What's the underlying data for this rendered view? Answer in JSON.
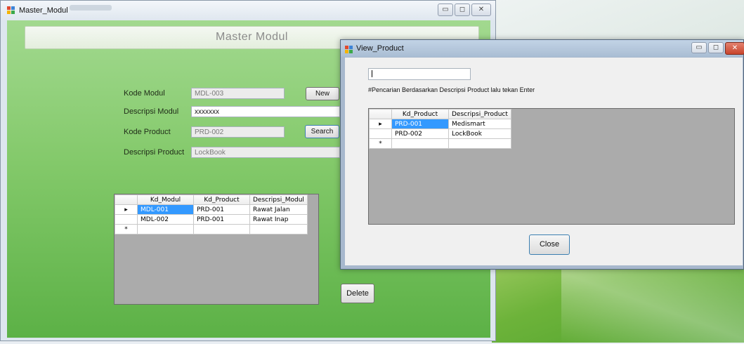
{
  "master": {
    "title": "Master_Modul",
    "header_title": "Master Modul",
    "labels": {
      "kode_modul": "Kode Modul",
      "descripsi_modul": "Descripsi Modul",
      "kode_product": "Kode Product",
      "descripsi_product": "Descripsi Product"
    },
    "fields": {
      "kode_modul": "MDL-003",
      "descripsi_modul": "xxxxxxx",
      "kode_product": "PRD-002",
      "descripsi_product": "LockBook"
    },
    "buttons": {
      "new": "New",
      "search": "Search",
      "delete": "Delete"
    },
    "grid": {
      "columns": [
        "Kd_Modul",
        "Kd_Product",
        "Descripsi_Modul"
      ],
      "rows": [
        [
          "MDL-001",
          "PRD-001",
          "Rawat Jalan"
        ],
        [
          "MDL-002",
          "PRD-001",
          "Rawat Inap"
        ]
      ],
      "new_row_marker": "*",
      "current_row_marker": "▸"
    }
  },
  "view_product": {
    "title": "View_Product",
    "search_value": "",
    "hint": "#Pencarian Berdasarkan Descripsi Product lalu tekan Enter",
    "grid": {
      "columns": [
        "Kd_Product",
        "Descripsi_Product"
      ],
      "rows": [
        [
          "PRD-001",
          "Medismart"
        ],
        [
          "PRD-002",
          "LockBook"
        ]
      ],
      "new_row_marker": "*",
      "current_row_marker": "▸"
    },
    "close_button": "Close"
  },
  "colors": {
    "form_green_top": "#a2d98f",
    "form_green_bottom": "#5cb146",
    "selection_blue": "#3399ff"
  }
}
